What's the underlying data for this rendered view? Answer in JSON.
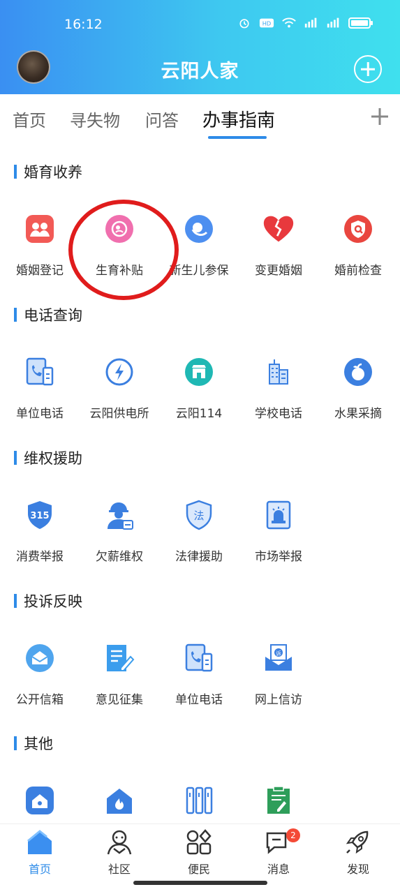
{
  "status_bar": {
    "time": "16:12"
  },
  "header": {
    "title": "云阳人家"
  },
  "tabs": [
    {
      "label": "首页"
    },
    {
      "label": "寻失物"
    },
    {
      "label": "问答"
    },
    {
      "label": "办事指南"
    }
  ],
  "sections": [
    {
      "title": "婚育收养",
      "items": [
        {
          "label": "婚姻登记",
          "icon": "couple-icon"
        },
        {
          "label": "生育补贴",
          "icon": "pregnancy-icon"
        },
        {
          "label": "新生儿参保",
          "icon": "newborn-icon"
        },
        {
          "label": "变更婚姻",
          "icon": "broken-heart-icon"
        },
        {
          "label": "婚前检查",
          "icon": "exam-icon"
        }
      ]
    },
    {
      "title": "电话查询",
      "items": [
        {
          "label": "单位电话",
          "icon": "phone-book-icon"
        },
        {
          "label": "云阳供电所",
          "icon": "power-icon"
        },
        {
          "label": "云阳114",
          "icon": "shop-icon"
        },
        {
          "label": "学校电话",
          "icon": "building-icon"
        },
        {
          "label": "水果采摘",
          "icon": "fruit-icon"
        }
      ]
    },
    {
      "title": "维权援助",
      "items": [
        {
          "label": "消费举报",
          "icon": "315-shield-icon"
        },
        {
          "label": "欠薪维权",
          "icon": "worker-icon"
        },
        {
          "label": "法律援助",
          "icon": "law-shield-icon"
        },
        {
          "label": "市场举报",
          "icon": "alarm-icon"
        }
      ]
    },
    {
      "title": "投诉反映",
      "items": [
        {
          "label": "公开信箱",
          "icon": "mailbox-icon"
        },
        {
          "label": "意见征集",
          "icon": "feedback-icon"
        },
        {
          "label": "单位电话",
          "icon": "phone-book-icon"
        },
        {
          "label": "网上信访",
          "icon": "letter-icon"
        }
      ]
    },
    {
      "title": "其他",
      "items": [
        {
          "icon": "home-service-icon"
        },
        {
          "icon": "fire-icon"
        },
        {
          "icon": "bars-icon"
        },
        {
          "icon": "document-icon"
        }
      ]
    }
  ],
  "sections_icons_text": {
    "s2_item3_badge": "315",
    "s2_item3_law": "法",
    "s3_item4_letter": "诉"
  },
  "bottom_nav": [
    {
      "label": "首页",
      "icon": "home-icon",
      "active": true
    },
    {
      "label": "社区",
      "icon": "community-icon"
    },
    {
      "label": "便民",
      "icon": "grid-icon"
    },
    {
      "label": "消息",
      "icon": "message-icon",
      "badge": "2"
    },
    {
      "label": "发现",
      "icon": "rocket-icon"
    }
  ],
  "colors": {
    "accent": "#2e8be8",
    "header_start": "#3a8ff2",
    "header_end": "#3fe0ee",
    "annotation": "#e01c1c"
  }
}
